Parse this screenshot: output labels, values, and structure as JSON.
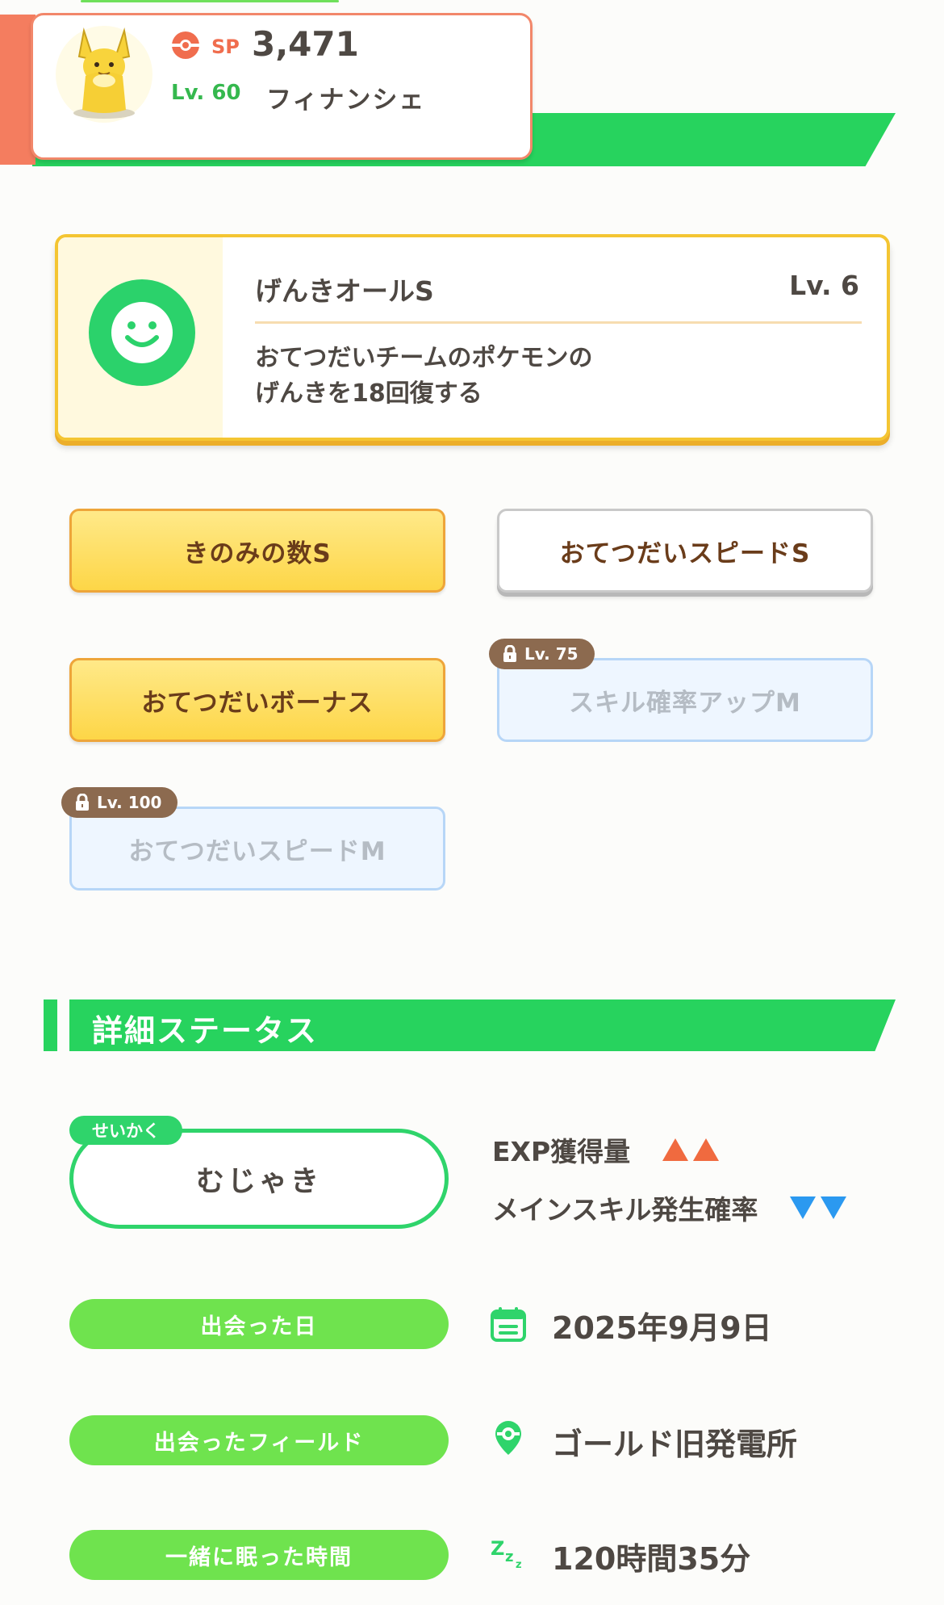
{
  "pokemon_card": {
    "sp_label": "SP",
    "sp_value": "3,471",
    "level_label": "Lv. 60",
    "name": "フィナンシェ"
  },
  "main_skill": {
    "name": "げんきオールS",
    "level": "Lv. 6",
    "description_line1": "おてつだいチームのポケモンの",
    "description_line2": "げんきを18回復する",
    "icon": "smile-face-icon"
  },
  "sub_skills": [
    {
      "label": "きのみの数S",
      "style": "gold",
      "locked": false
    },
    {
      "label": "おてつだいスピードS",
      "style": "white",
      "locked": false
    },
    {
      "label": "おてつだいボーナス",
      "style": "gold",
      "locked": false
    },
    {
      "label": "スキル確率アップM",
      "style": "locked",
      "locked": true,
      "unlock_level": "Lv. 75"
    },
    {
      "label": "おてつだいスピードM",
      "style": "locked",
      "locked": true,
      "unlock_level": "Lv. 100"
    }
  ],
  "details": {
    "section_title": "詳細ステータス",
    "nature": {
      "tag": "せいかく",
      "value": "むじゃき",
      "up_stat": "EXP獲得量",
      "down_stat": "メインスキル発生確率"
    },
    "met_date": {
      "label": "出会った日",
      "value": "2025年9月9日",
      "icon": "calendar-icon"
    },
    "met_field": {
      "label": "出会ったフィールド",
      "value": "ゴールド旧発電所",
      "icon": "map-pin-icon"
    },
    "sleep_time": {
      "label": "一緒に眠った時間",
      "value": "120時間35分",
      "icon": "zzz-icon"
    }
  },
  "colors": {
    "accent_green": "#27d35e",
    "pill_green": "#6fe34e",
    "salmon": "#f47d5f",
    "gold_border": "#f4c532",
    "up_arrow": "#f06a3f",
    "down_arrow": "#2b99f0",
    "lock_badge": "#8c6a4f"
  }
}
